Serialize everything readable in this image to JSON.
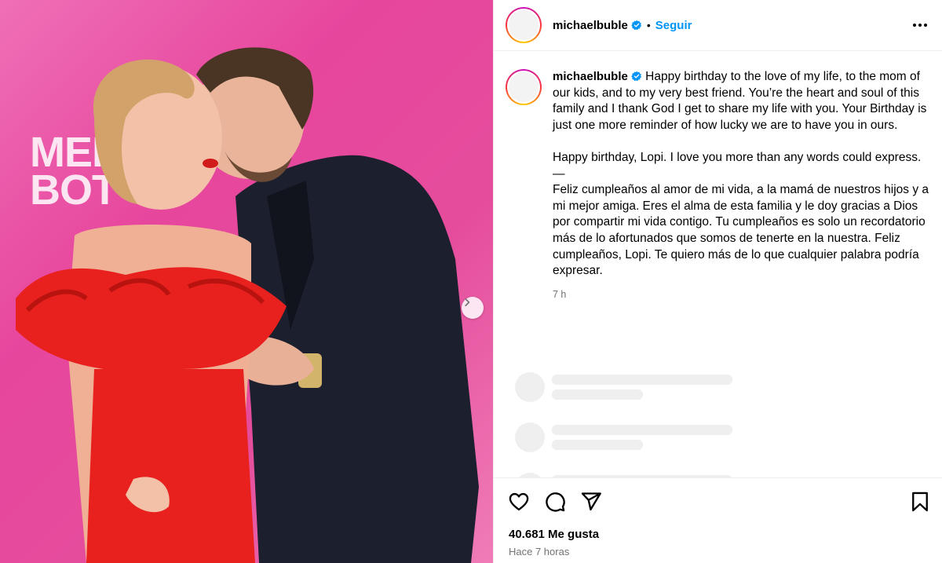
{
  "post": {
    "username": "michaelbuble",
    "separator": "•",
    "follow_label": "Seguir",
    "more_icon": "more-horizontal-icon",
    "caption": "Happy birthday to the love of my life, to the mom of our kids, and to my very best friend. You’re the heart and soul of this family and I thank God I get to share my life with you. Your Birthday is just one more reminder of how lucky we are to have you in ours.\n\nHappy birthday, Lopi. I love you more than any words could express.\n—\nFeliz cumpleaños al amor de mi vida, a la mamá de nuestros hijos y a mi mejor amiga. Eres el alma de esta familia y le doy gracias a Dios por compartir mi vida contigo. Tu cumpleaños es solo un recordatorio más de lo afortunados que somos de tenerte en la nuestra. Feliz cumpleaños, Lopi. Te quiero más de lo que cualquier palabra podría expresar.",
    "caption_time": "7 h",
    "likes": "40.681 Me gusta",
    "time_ago": "Hace 7 horas"
  },
  "photo": {
    "backdrop_text_line1": "MEI",
    "backdrop_text_line2": "BOT"
  },
  "icons": {
    "like": "heart-icon",
    "comment": "comment-icon",
    "share": "send-icon",
    "save": "bookmark-icon",
    "verified": "verified-badge-icon",
    "next": "chevron-right-icon"
  },
  "colors": {
    "accent": "#0095f6",
    "verified": "#0095f6",
    "backdrop": "#e7469d",
    "dress": "#e8211f",
    "muted_text": "#737373"
  }
}
